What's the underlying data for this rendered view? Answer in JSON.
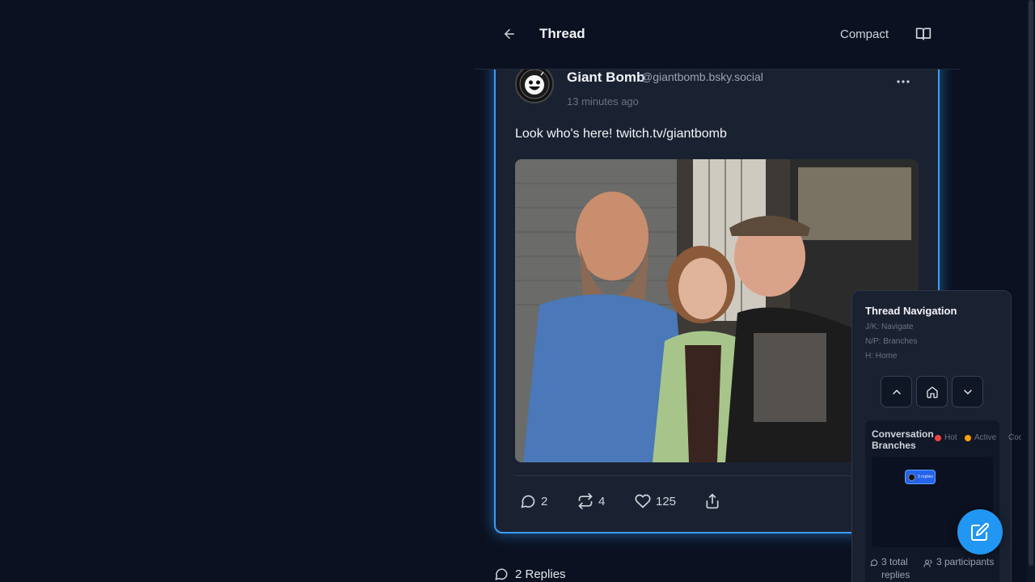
{
  "header": {
    "title": "Thread",
    "compact_label": "Compact",
    "back_icon": "arrow-left-icon",
    "book_icon": "book-icon"
  },
  "post": {
    "author_name": "Giant Bomb",
    "author_handle": "@giantbomb.bsky.social",
    "timestamp": "13 minutes ago",
    "text": "Look who's here! twitch.tv/giantbomb",
    "image_alt": "Three people posing together on a porch at night",
    "actions": {
      "replies": "2",
      "reposts": "4",
      "likes": "125"
    }
  },
  "replies_heading": "2 Replies",
  "thread_nav": {
    "title": "Thread Navigation",
    "hints": [
      "J/K: Navigate",
      "N/P: Branches",
      "H: Home"
    ],
    "branches_title": "Conversation Branches",
    "legend": [
      {
        "label": "Hot",
        "color": "#ef4444"
      },
      {
        "label": "Active",
        "color": "#f59e0b"
      },
      {
        "label": "Cool",
        "color": "#6b7280"
      }
    ],
    "node_label": "3 replies",
    "total_replies": "3 total replies",
    "participants": "3 participants"
  },
  "colors": {
    "accent": "#3b9cf6",
    "fab": "#2196f3",
    "background": "#0b1120",
    "card": "#1a2232"
  }
}
